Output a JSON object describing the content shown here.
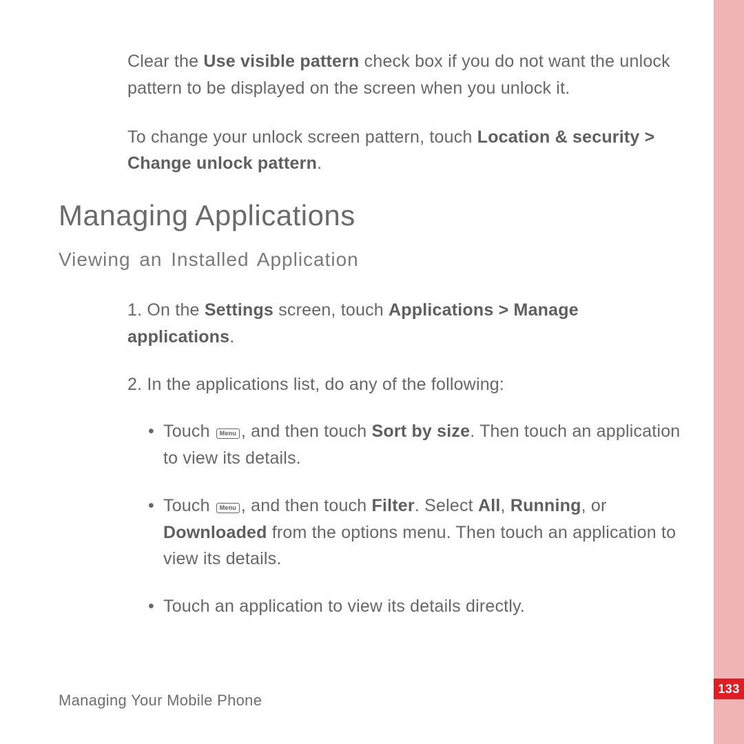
{
  "intro": {
    "para1_a": "Clear the ",
    "para1_b_bold": "Use visible pattern",
    "para1_c": " check box if you do not want the unlock pattern to be displayed on the screen when you unlock it.",
    "para2_a": "To change your unlock screen pattern, touch ",
    "para2_b_bold": "Location & security",
    "para2_gt": " > ",
    "para2_c_bold": "Change unlock pattern",
    "para2_d": "."
  },
  "heading1": "Managing Applications",
  "heading2": "Viewing an Installed Application",
  "steps": {
    "s1_num": "1. ",
    "s1_a": "On the ",
    "s1_b_bold": "Settings",
    "s1_c": " screen, touch ",
    "s1_d_bold": "Applications",
    "s1_gt": " > ",
    "s1_e_bold": "Manage applications",
    "s1_f": ".",
    "s2_num": "2. ",
    "s2_a": "In the applications list, do any of the following:"
  },
  "bullets": {
    "b1_a": "Touch ",
    "b1_menu": "Menu",
    "b1_b": ", and then touch ",
    "b1_c_bold": "Sort by size",
    "b1_d": ". Then touch an application to view its details.",
    "b2_a": "Touch ",
    "b2_menu": "Menu",
    "b2_b": ", and then touch ",
    "b2_c_bold": "Filter",
    "b2_d": ". Select ",
    "b2_e_bold": "All",
    "b2_f": ", ",
    "b2_g_bold": "Running",
    "b2_h": ", or ",
    "b2_i_bold": "Downloaded",
    "b2_j": " from the options menu. Then touch an application to view its details.",
    "b3": "Touch an application to view its details directly."
  },
  "footer": "Managing Your Mobile Phone",
  "page_number": "133"
}
